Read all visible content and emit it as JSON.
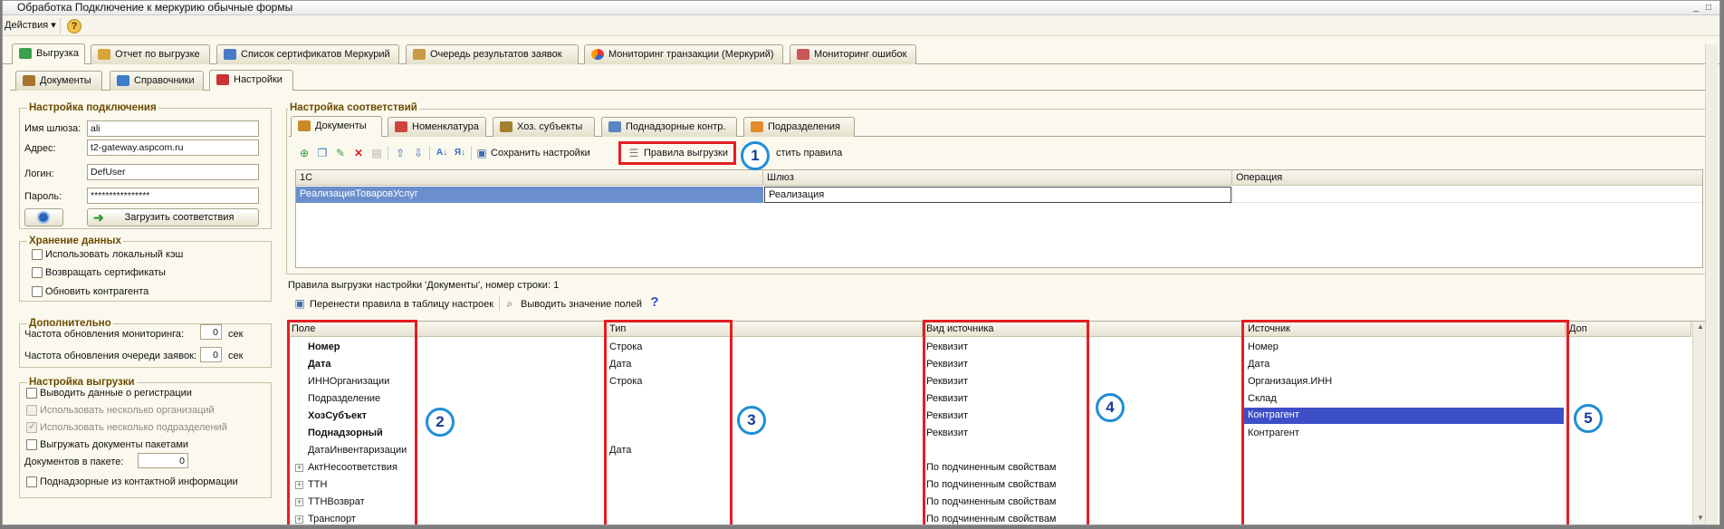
{
  "window": {
    "title": "Обработка  Подключение к меркурию обычные формы"
  },
  "menubar": {
    "actions": "Действия",
    "help": "?"
  },
  "main_tabs": [
    "Выгрузка",
    "Отчет по выгрузке",
    "Список сертификатов Меркурий",
    "Очередь результатов заявок",
    "Мониторинг транзакции (Меркурий)",
    "Мониторинг ошибок"
  ],
  "sub_tabs": [
    "Документы",
    "Справочники",
    "Настройки"
  ],
  "connection": {
    "title": "Настройка подключения",
    "gateway_label": "Имя шлюза:",
    "gateway_value": "ali",
    "address_label": "Адрес:",
    "address_value": "t2-gateway.aspcom.ru",
    "login_label": "Логин:",
    "login_value": "DefUser",
    "password_label": "Пароль:",
    "password_value": "****************",
    "load_button": "Загрузить соответствия"
  },
  "storage": {
    "title": "Хранение данных",
    "items": [
      "Использовать локальный кэш",
      "Возвращать сертификаты",
      "Обновить контрагента"
    ]
  },
  "extra": {
    "title": "Дополнительно",
    "monitor_label": "Частота обновления мониторинга:",
    "monitor_value": "0",
    "monitor_unit": "сек",
    "queue_label": "Частота обновления очереди заявок:",
    "queue_value": "0",
    "queue_unit": "сек"
  },
  "export_settings": {
    "title": "Настройка выгрузки",
    "items": [
      "Выводить данные о регистрации",
      "Использовать несколько организаций",
      "Использовать несколько подразделений",
      "Выгружать документы пакетами"
    ],
    "docs_label": "Документов в пакете:",
    "docs_value": "0",
    "last_item": "Поднадзорные из контактной информации"
  },
  "mapping": {
    "title": "Настройка соответствий",
    "tabs": [
      "Документы",
      "Номенклатура",
      "Хоз. субъекты",
      "Поднадзорные контр.",
      "Подразделения"
    ],
    "toolbar": {
      "save": "Сохранить настройки",
      "rules": "Правила выгрузки",
      "clear": "стить правила"
    },
    "columns": [
      "1С",
      "Шлюз",
      "Операция"
    ],
    "rows": [
      [
        "РеализацияТоваровУслуг",
        "Реализация",
        ""
      ]
    ]
  },
  "rules": {
    "caption": "Правила выгрузки настройки 'Документы', номер строки: 1",
    "transfer": "Перенести правила в таблицу настроек",
    "show_values": "Выводить значение полей",
    "columns": [
      "Поле",
      "Тип",
      "Вид источника",
      "Источник",
      "Доп"
    ],
    "rows": [
      {
        "field": "Номер",
        "bold": true,
        "type": "Строка",
        "kind": "Реквизит",
        "source": "Номер"
      },
      {
        "field": "Дата",
        "bold": true,
        "type": "Дата",
        "kind": "Реквизит",
        "source": "Дата"
      },
      {
        "field": "ИННОрганизации",
        "bold": false,
        "type": "Строка",
        "kind": "Реквизит",
        "source": "Организация.ИНН"
      },
      {
        "field": "Подразделение",
        "bold": false,
        "type": "",
        "kind": "Реквизит",
        "source": "Склад"
      },
      {
        "field": "ХозСубъект",
        "bold": true,
        "type": "",
        "kind": "Реквизит",
        "source": "Контрагент"
      },
      {
        "field": "Поднадзорный",
        "bold": true,
        "type": "",
        "kind": "Реквизит",
        "source": "Контрагент"
      },
      {
        "field": "ДатаИнвентаризации",
        "bold": false,
        "type": "Дата",
        "kind": "",
        "source": ""
      },
      {
        "field": "АктНесоответствия",
        "bold": false,
        "type": "",
        "kind": "По подчиненным свойствам",
        "source": ""
      },
      {
        "field": "ТТН",
        "bold": false,
        "type": "",
        "kind": "По подчиненным свойствам",
        "source": ""
      },
      {
        "field": "ТТНВозврат",
        "bold": false,
        "type": "",
        "kind": "По подчиненным свойствам",
        "source": ""
      },
      {
        "field": "Транспорт",
        "bold": false,
        "type": "",
        "kind": "По подчиненным свойствам",
        "source": ""
      }
    ]
  },
  "annotations": [
    "1",
    "2",
    "3",
    "4",
    "5"
  ]
}
